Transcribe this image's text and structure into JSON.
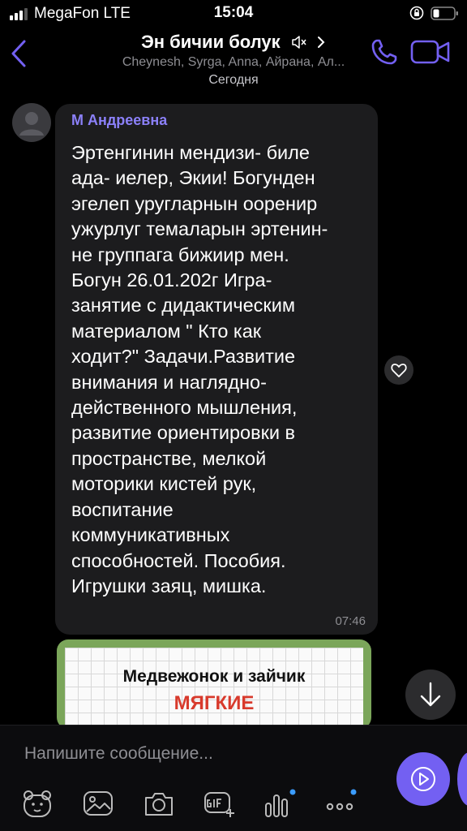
{
  "status_bar": {
    "carrier": "MegaFon  LTE",
    "time": "15:04"
  },
  "header": {
    "title": "Эн бичии болук",
    "subtitle": "Cheynesh, Syrga, Anna, Айрана, Ал..."
  },
  "date_divider": "Сегодня",
  "message": {
    "sender": "М Андреевна",
    "lines": [
      "Эртенгинин мендизи- биле",
      "ада- иелер, Экии! Богунден",
      "эгелеп уругларнын ооренир",
      "ужурлуг темаларын эртенин-",
      "не группага бижиир мен.",
      "Богун 26.01.202г Игра-",
      "занятие с дидактическим",
      "материалом \" Кто как",
      "ходит?\" Задачи.Развитие",
      "внимания и наглядно-",
      "действенного мышления,",
      "развитие ориентировки в",
      "пространстве, мелкой",
      "моторики кистей рук,",
      "воспитание",
      "коммуникативных",
      "способностей. Пособия.",
      "Игрушки заяц, мишка."
    ],
    "time": "07:46"
  },
  "image_message": {
    "title": "Медвежонок и зайчик",
    "subtitle": "МЯГКИЕ"
  },
  "composer": {
    "placeholder": "Напишите сообщение..."
  },
  "toolbar": [
    "sticker-icon",
    "gallery-icon",
    "camera-icon",
    "gif-icon",
    "poll-icon",
    "more-icon"
  ],
  "colors": {
    "accent": "#7360f2",
    "sender_name": "#8b80f9",
    "bubble": "#1c1c1e",
    "background": "#000000"
  }
}
